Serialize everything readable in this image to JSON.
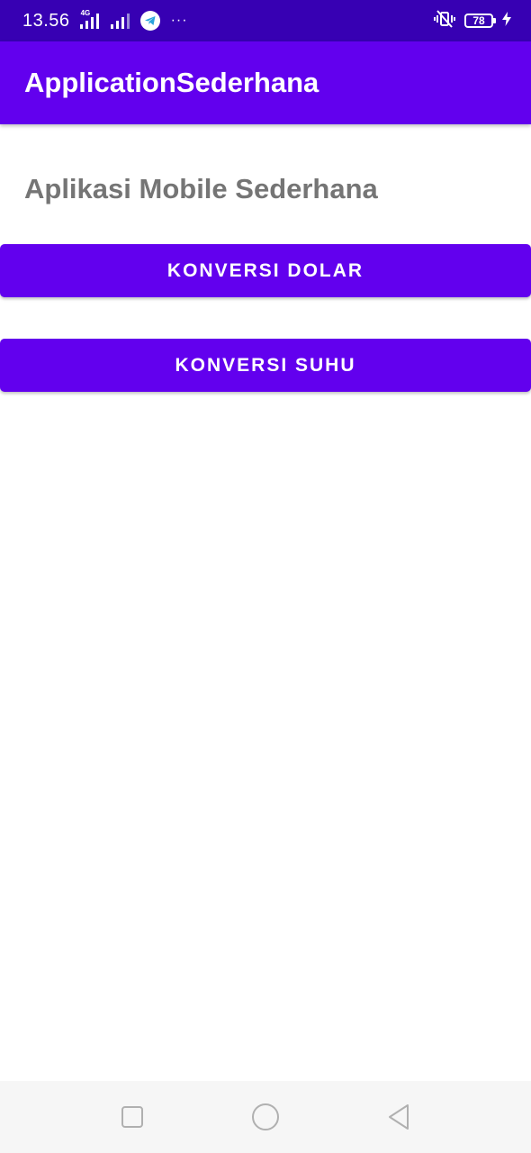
{
  "status_bar": {
    "time": "13.56",
    "network_label": "4G",
    "more_indicator": "···",
    "battery_level": "78",
    "icons": [
      "signal-4g-icon",
      "signal-icon",
      "telegram-icon",
      "vibrate-icon",
      "battery-icon",
      "charging-icon"
    ]
  },
  "app_bar": {
    "title": "ApplicationSederhana"
  },
  "main": {
    "heading": "Aplikasi Mobile Sederhana",
    "buttons": {
      "konversi_dolar": "KONVERSI DOLAR",
      "konversi_suhu": "KONVERSI SUHU"
    }
  },
  "nav_bar": {
    "icons": [
      "recent-apps-icon",
      "home-icon",
      "back-icon"
    ]
  },
  "colors": {
    "status_bar": "#3700b3",
    "primary": "#6200ee",
    "heading_text": "#757575",
    "nav_bar": "#f6f6f6"
  }
}
